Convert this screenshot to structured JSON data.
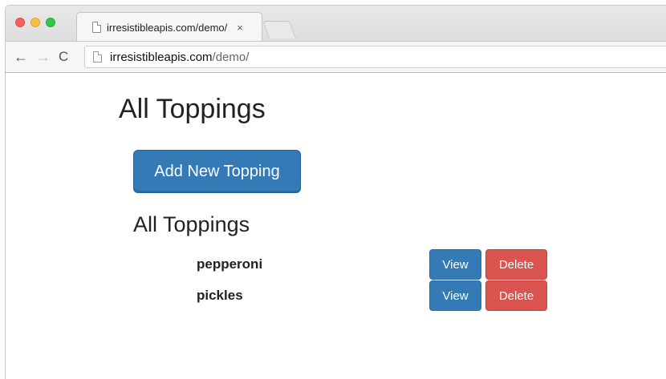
{
  "browser": {
    "tab": {
      "title": "irresistibleapis.com/demo/",
      "close_label": "×"
    },
    "toolbar": {
      "back_label": "←",
      "forward_label": "→",
      "reload_label": "C"
    },
    "address": {
      "host": "irresistibleapis.com",
      "path": "/demo/"
    }
  },
  "page": {
    "title": "All Toppings",
    "add_button_label": "Add New Topping",
    "section_title": "All Toppings",
    "toppings": [
      {
        "name": "pepperoni",
        "view_label": "View",
        "delete_label": "Delete"
      },
      {
        "name": "pickles",
        "view_label": "View",
        "delete_label": "Delete"
      }
    ]
  },
  "colors": {
    "primary": "#337ab7",
    "danger": "#d9534f"
  }
}
